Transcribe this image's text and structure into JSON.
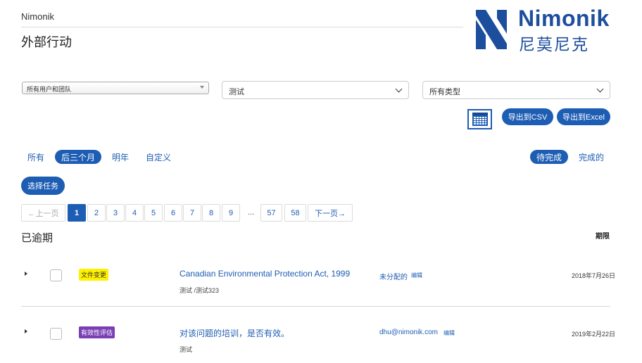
{
  "header": {
    "app_name": "Nimonik",
    "page_title": "外部行动",
    "logo_en": "Nimonik",
    "logo_cn": "尼莫尼克",
    "brand_color": "#1d4e9e"
  },
  "filters": {
    "users_select": "所有用户和团队",
    "text_select": "测试",
    "type_select": "所有类型"
  },
  "actions": {
    "calendar_icon": "calendar-icon",
    "export_csv": "导出到CSV",
    "export_excel": "导出到Excel"
  },
  "range_tabs": [
    "所有",
    "后三个月",
    "明年",
    "自定义"
  ],
  "range_active": "后三个月",
  "status_tabs": [
    "待完成",
    "完成的"
  ],
  "status_active": "待完成",
  "select_tasks": "选择任务",
  "pagination": {
    "prev": "←上一页",
    "pages": [
      "1",
      "2",
      "3",
      "4",
      "5",
      "6",
      "7",
      "8",
      "9"
    ],
    "ellipsis": "...",
    "tail_pages": [
      "57",
      "58"
    ],
    "next": "下一页→",
    "current": "1"
  },
  "section": {
    "title": "已逾期",
    "deadline_header": "期限"
  },
  "tasks": [
    {
      "tag": "文件变更",
      "tag_color": "#fff200",
      "title": "Canadian Environmental Protection Act, 1999",
      "subtitle": "测试 /测试323",
      "assignee": "未分配的",
      "edit": "编辑",
      "due": "2018年7月26日"
    },
    {
      "tag": "有效性评估",
      "tag_color": "#7b3fb5",
      "title": "对该问题的培训，是否有效。",
      "subtitle": "测试",
      "assignee": "dhu@nimonik.com",
      "edit": "编辑",
      "due": "2019年2月22日"
    }
  ]
}
